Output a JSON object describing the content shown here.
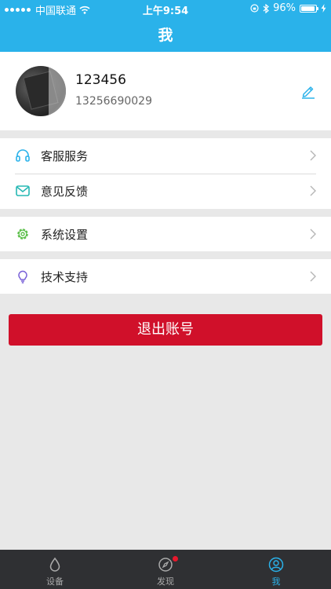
{
  "status_bar": {
    "carrier": "中国联通",
    "time": "上午9:54",
    "battery": "96%",
    "battery_level": 0.96
  },
  "header": {
    "title": "我"
  },
  "profile": {
    "username": "123456",
    "phone": "13256690029",
    "avatar_icon": "user-photo",
    "edit_icon": "pencil-icon"
  },
  "menu": {
    "customer_service": {
      "label": "客服服务",
      "icon": "headphones-icon"
    },
    "feedback": {
      "label": "意见反馈",
      "icon": "envelope-icon"
    },
    "settings": {
      "label": "系统设置",
      "icon": "gear-icon"
    },
    "support": {
      "label": "技术支持",
      "icon": "lightbulb-icon"
    }
  },
  "logout": {
    "label": "退出账号"
  },
  "tabs": [
    {
      "label": "设备",
      "icon": "water-drop-icon",
      "active": false
    },
    {
      "label": "发现",
      "icon": "compass-icon",
      "active": false,
      "has_badge": true
    },
    {
      "label": "我",
      "icon": "user-circle-icon",
      "active": true
    }
  ],
  "colors": {
    "primary": "#2ab2ea",
    "logout_red": "#d0102a",
    "tabbar_bg": "#2f3033",
    "page_bg": "#e8e8e8"
  }
}
